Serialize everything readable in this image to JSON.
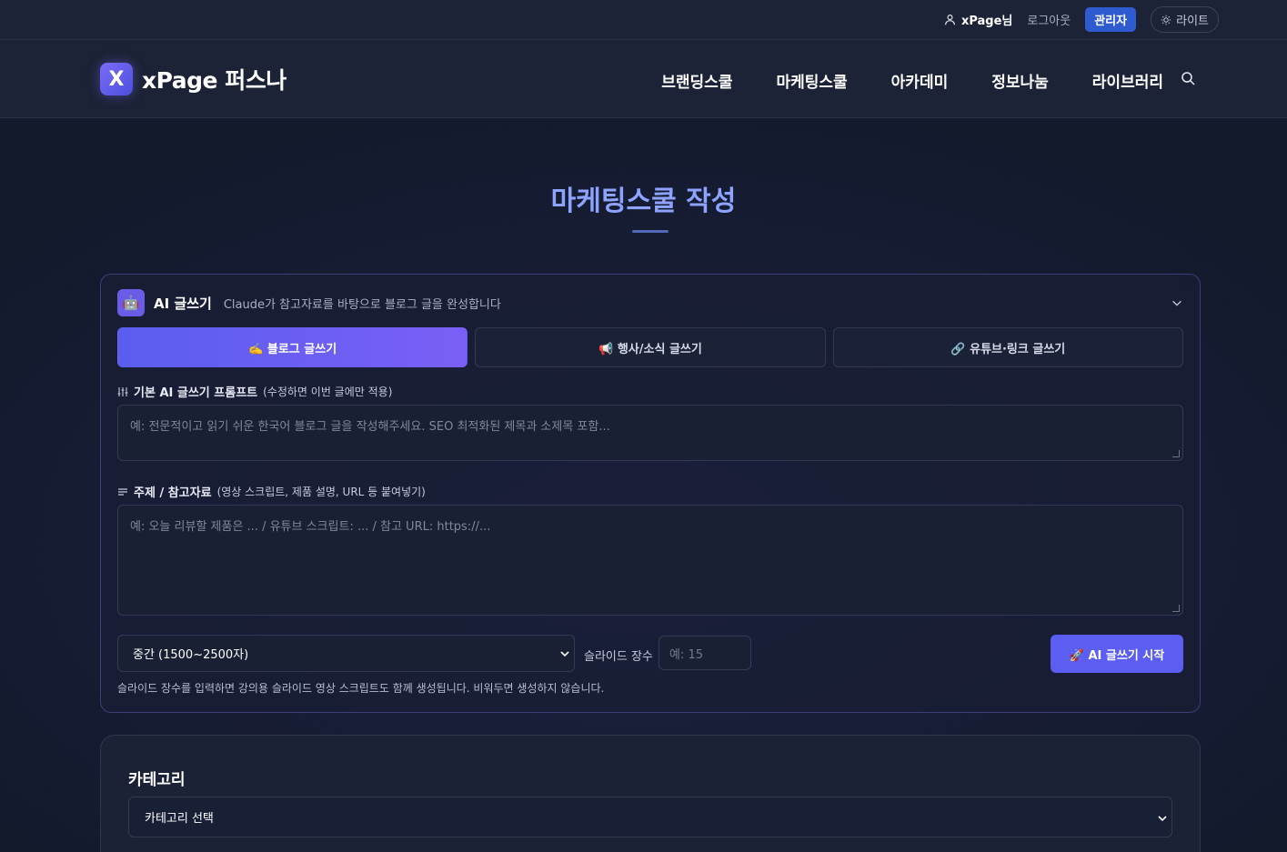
{
  "topbar": {
    "user": "xPage님",
    "logout": "로그아웃",
    "admin": "관리자",
    "theme": "라이트"
  },
  "header": {
    "logo_mark": "X",
    "logo_text": "xPage 퍼스나",
    "nav": [
      "브랜딩스쿨",
      "마케팅스쿨",
      "아카데미",
      "정보나눔",
      "라이브러리"
    ]
  },
  "page": {
    "title": "마케팅스쿨 작성"
  },
  "ai_writer": {
    "title": "AI 글쓰기",
    "subtitle": "Claude가 참고자료를 바탕으로 블로그 글을 완성합니다",
    "tabs": [
      {
        "label": "✍️ 블로그 글쓰기",
        "active": true
      },
      {
        "label": "📢 행사/소식 글쓰기",
        "active": false
      },
      {
        "label": "🔗 유튜브·링크 글쓰기",
        "active": false
      }
    ],
    "prompt_label": "기본 AI 글쓰기 프롬프트",
    "prompt_hint": "(수정하면 이번 글에만 적용)",
    "prompt_placeholder": "예: 전문적이고 읽기 쉬운 한국어 블로그 글을 작성해주세요. SEO 최적화된 제목과 소제목 포함...",
    "ref_label": "주제 / 참고자료",
    "ref_hint": "(영상 스크립트, 제품 설명, URL 등 붙여넣기)",
    "ref_placeholder": "예: 오늘 리뷰할 제품은 ... / 유튜브 스크립트: ... / 참고 URL: https://...",
    "length_select": "중간 (1500~2500자)",
    "slide_label": "슬라이드 장수",
    "slide_placeholder": "예: 15",
    "start_button": "🚀 AI 글쓰기 시작",
    "note": "슬라이드 장수를 입력하면 강의용 슬라이드 영상 스크립트도 함께 생성됩니다. 비워두면 생성하지 않습니다."
  },
  "category": {
    "title": "카테고리",
    "select": "카테고리 선택"
  },
  "colors": {
    "accent": "#5b5ef0",
    "title": "#8ea3ff",
    "admin": "#2f5bd1",
    "background": "#131a2c"
  }
}
